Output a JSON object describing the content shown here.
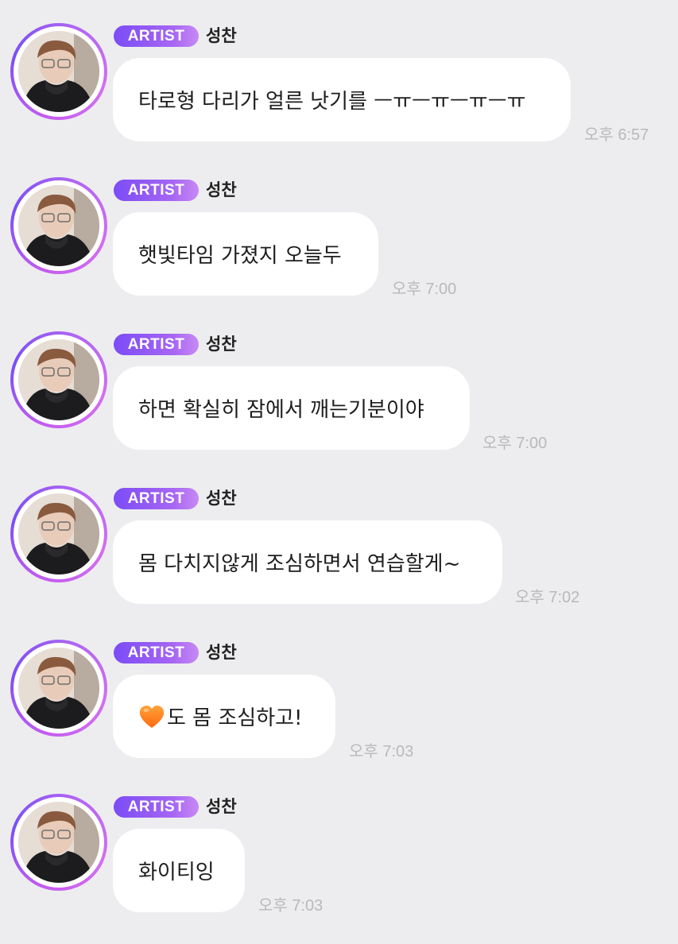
{
  "messages": [
    {
      "badge": "ARTIST",
      "sender": "성찬",
      "text": "타로형 다리가 얼른 낫기를 ㅡㅠㅡㅠㅡㅠㅡㅠ",
      "time": "오후 6:57",
      "emoji": ""
    },
    {
      "badge": "ARTIST",
      "sender": "성찬",
      "text": "햇빛타임 가졌지 오늘두",
      "time": "오후 7:00",
      "emoji": ""
    },
    {
      "badge": "ARTIST",
      "sender": "성찬",
      "text": "하면 확실히 잠에서 깨는기분이야",
      "time": "오후 7:00",
      "emoji": ""
    },
    {
      "badge": "ARTIST",
      "sender": "성찬",
      "text": "몸 다치지않게 조심하면서 연습할게~",
      "time": "오후 7:02",
      "emoji": ""
    },
    {
      "badge": "ARTIST",
      "sender": "성찬",
      "text": "도 몸 조심하고!",
      "time": "오후 7:03",
      "emoji": "orange-heart-icon"
    },
    {
      "badge": "ARTIST",
      "sender": "성찬",
      "text": "화이티잉",
      "time": "오후 7:03",
      "emoji": ""
    }
  ],
  "colors": {
    "background": "#ededef",
    "bubble": "#ffffff",
    "badge_start": "#7b4cf6",
    "badge_end": "#c889f4",
    "timestamp": "#b9b9bd",
    "heart": "#ff7a1a"
  }
}
